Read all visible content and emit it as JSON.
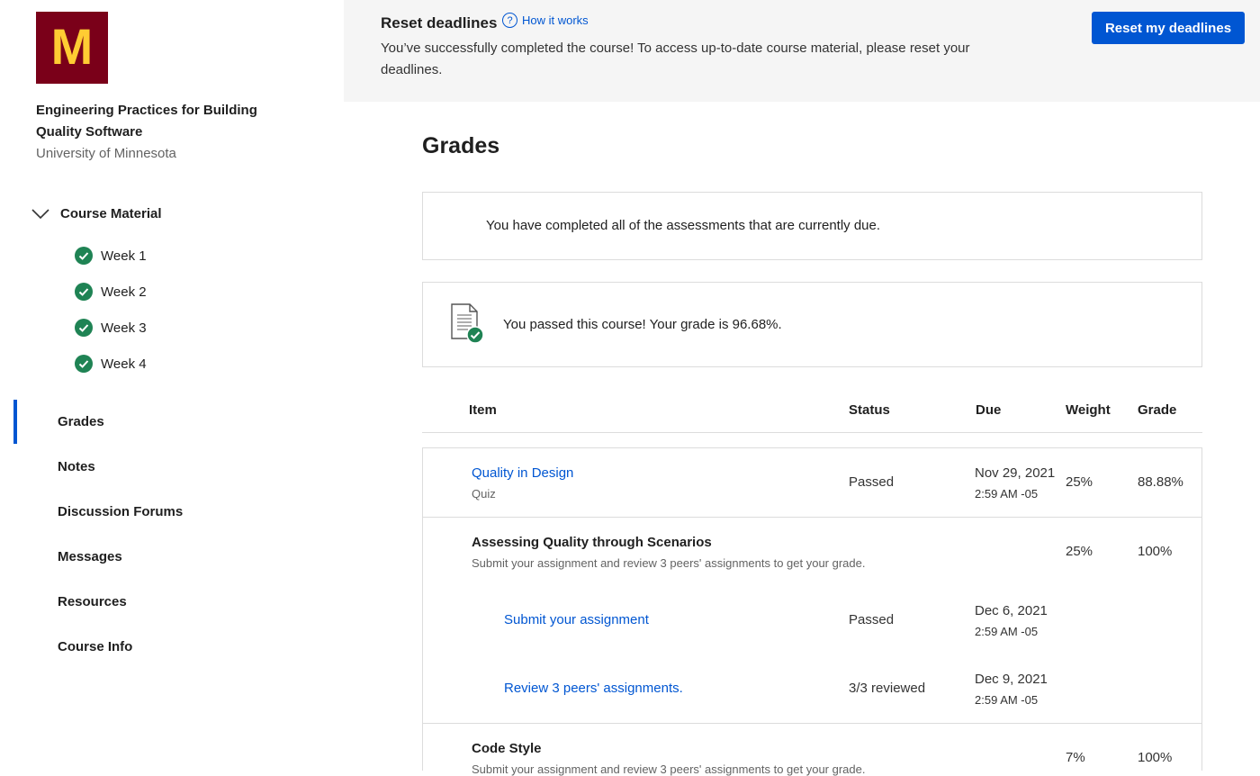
{
  "sidebar": {
    "logo_letter": "M",
    "course_title": "Engineering Practices for Building Quality Software",
    "university": "University of Minnesota",
    "course_material_label": "Course Material",
    "weeks": [
      "Week 1",
      "Week 2",
      "Week 3",
      "Week 4"
    ],
    "nav": [
      "Grades",
      "Notes",
      "Discussion Forums",
      "Messages",
      "Resources",
      "Course Info"
    ],
    "active_nav": "Grades"
  },
  "banner": {
    "title": "Reset deadlines",
    "how_it_works": "How it works",
    "message": "You’ve successfully completed the course! To access up-to-date course material, please reset your deadlines.",
    "button": "Reset my deadlines"
  },
  "main": {
    "heading": "Grades",
    "completed_msg": "You have completed all of the assessments that are currently due.",
    "passed_msg": "You passed this course! Your grade is 96.68%.",
    "columns": [
      "Item",
      "Status",
      "Due",
      "Weight",
      "Grade"
    ],
    "rows": [
      {
        "title": "Quality in Design",
        "sub": "Quiz",
        "status": "Passed",
        "due_date": "Nov 29, 2021",
        "due_time": "2:59 AM -05",
        "weight": "25%",
        "grade": "88.88%"
      },
      {
        "title": "Assessing Quality through Scenarios",
        "sub": "Submit your assignment and review 3 peers' assignments to get your grade.",
        "weight": "25%",
        "grade": "100%",
        "children": [
          {
            "title": "Submit your assignment",
            "status": "Passed",
            "due_date": "Dec 6, 2021",
            "due_time": "2:59 AM -05"
          },
          {
            "title": "Review 3 peers' assignments.",
            "status": "3/3 reviewed",
            "due_date": "Dec 9, 2021",
            "due_time": "2:59 AM -05"
          }
        ]
      },
      {
        "title": "Code Style",
        "sub": "Submit your assignment and review 3 peers' assignments to get your grade.",
        "weight": "7%",
        "grade": "100%"
      }
    ]
  },
  "colors": {
    "brand_maroon": "#7a0019",
    "brand_gold": "#ffcc33",
    "accent_blue": "#0056d2",
    "success_green": "#1f8354"
  }
}
